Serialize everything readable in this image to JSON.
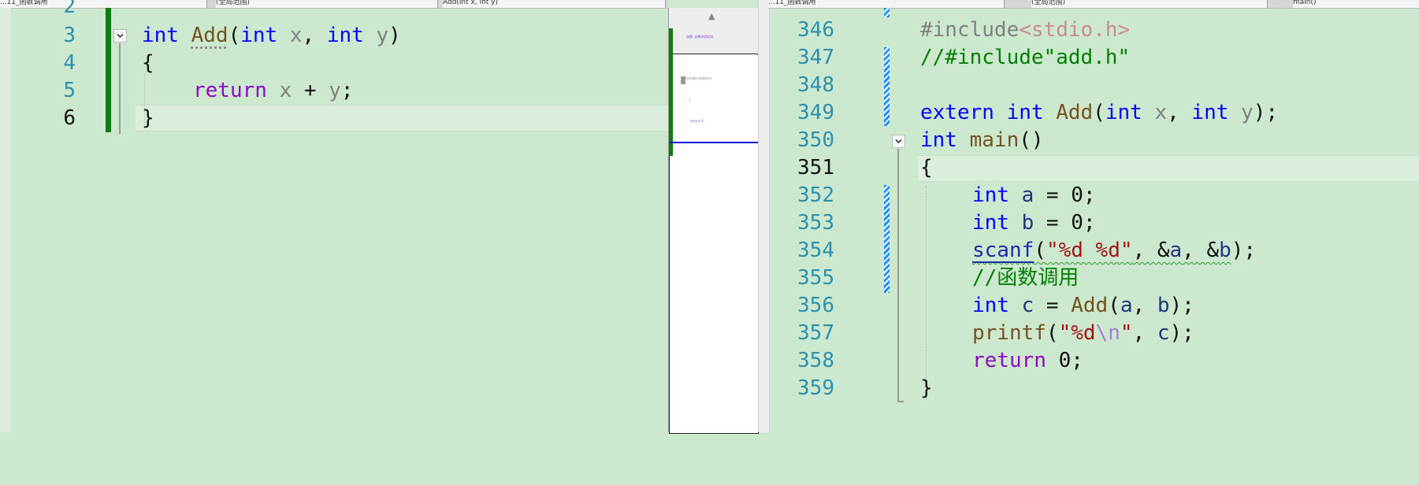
{
  "left_editor": {
    "nav_file": "...11_函数调用",
    "nav_scope": "(全局范围)",
    "nav_member": "Add(int x, int y)",
    "lines": [
      {
        "num": "2"
      },
      {
        "num": "3",
        "t_kw1": "int",
        "t_fn": "Add",
        "t_p1": "(",
        "t_kw2": "int",
        "t_x": "x",
        "t_c": ", ",
        "t_kw3": "int",
        "t_y": "y",
        "t_p2": ")"
      },
      {
        "num": "4",
        "t_brace": "{"
      },
      {
        "num": "5",
        "t_ret": "return",
        "t_x": "x",
        "t_op": " + ",
        "t_y": "y",
        "t_semi": ";"
      },
      {
        "num": "6",
        "t_brace": "}"
      }
    ]
  },
  "minimap": {
    "scroll_up": "▲",
    "snippet1": "函数: 函数调用相关",
    "snippet2": "#include<stdio.h>",
    "snippet3": "}",
    "snippet4": "return 0;"
  },
  "right_editor": {
    "nav_file": "...11_函数调用",
    "nav_scope": "(全局范围)",
    "nav_member": "main()",
    "lines": [
      {
        "num": "346",
        "t_pre": "#include",
        "t_inc": "<stdio.h>"
      },
      {
        "num": "347",
        "t_cmt": "//#include\"add.h\""
      },
      {
        "num": "348"
      },
      {
        "num": "349",
        "t_kw1": "extern",
        "t_kw2": "int",
        "t_fn": "Add",
        "t_p1": "(",
        "t_kw3": "int",
        "t_x": "x",
        "t_c": ", ",
        "t_kw4": "int",
        "t_y": "y",
        "t_p2": ");"
      },
      {
        "num": "350",
        "t_kw1": "int",
        "t_fn": "main",
        "t_p": "()"
      },
      {
        "num": "351",
        "t_brace": "{"
      },
      {
        "num": "352",
        "t_kw": "int",
        "t_var": "a",
        "t_rest": " = 0;"
      },
      {
        "num": "353",
        "t_kw": "int",
        "t_var": "b",
        "t_rest": " = 0;"
      },
      {
        "num": "354",
        "t_fn": "scanf",
        "t_p1": "(",
        "t_str": "\"%d %d\"",
        "t_c1": ", &",
        "t_a": "a",
        "t_c2": ", &",
        "t_b": "b",
        "t_p2": ");"
      },
      {
        "num": "355",
        "t_cmt": "//函数调用"
      },
      {
        "num": "356",
        "t_kw": "int",
        "t_var": "c",
        "t_eq": " = ",
        "t_fn": "Add",
        "t_p1": "(",
        "t_a": "a",
        "t_c": ", ",
        "t_b": "b",
        "t_p2": ");"
      },
      {
        "num": "357",
        "t_fn": "printf",
        "t_p1": "(",
        "t_str1": "\"%d",
        "t_esc": "\\n",
        "t_str2": "\"",
        "t_c": ", ",
        "t_cv": "c",
        "t_p2": ");"
      },
      {
        "num": "358",
        "t_ret": "return",
        "t_rest": " 0;"
      },
      {
        "num": "359",
        "t_brace": "}"
      }
    ]
  },
  "colors": {
    "background": "#cce8cf",
    "keyword": "#0000ff",
    "control_keyword": "#8f08c4",
    "function": "#74531f",
    "string": "#a31515",
    "comment": "#008000",
    "line_number": "#2b91af",
    "change_bar": "#107c10",
    "saved_bar": "#1e90ff"
  }
}
